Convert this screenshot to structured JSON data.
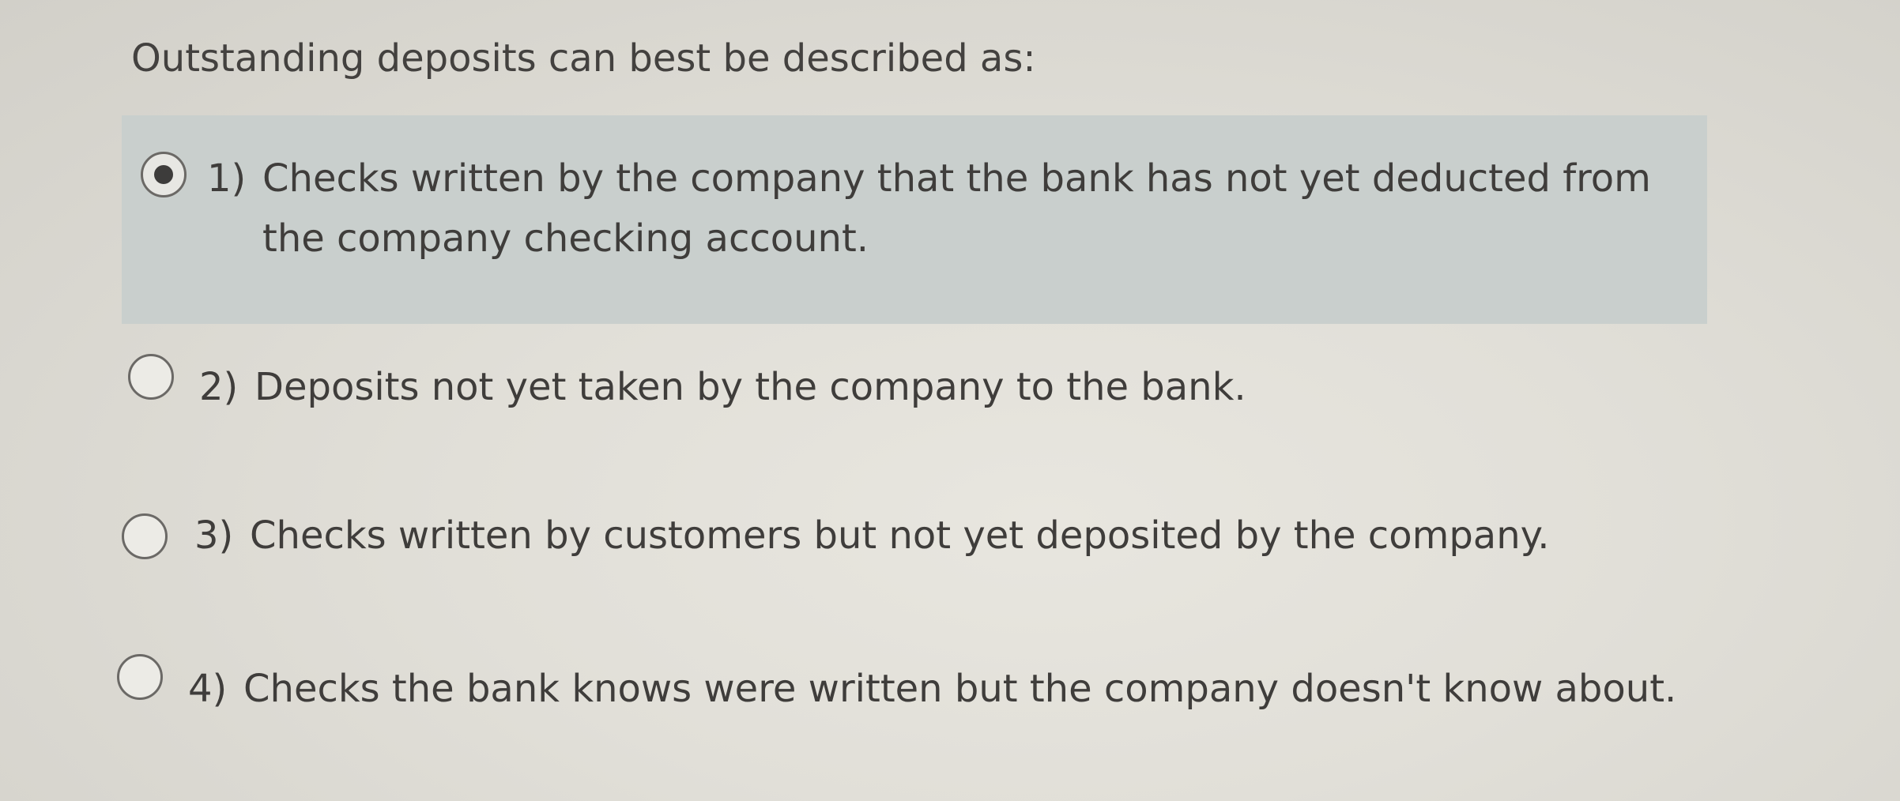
{
  "question": {
    "text": "Outstanding deposits can best be described as:"
  },
  "options": [
    {
      "number": "1)",
      "label": "Checks written by the company that the bank has not yet deducted from the company checking account.",
      "selected": true
    },
    {
      "number": "2)",
      "label": "Deposits not yet taken by the company to the bank.",
      "selected": false
    },
    {
      "number": "3)",
      "label": "Checks written by customers but not yet deposited by the company.",
      "selected": false
    },
    {
      "number": "4)",
      "label": "Checks the bank knows were written but the company doesn't know about.",
      "selected": false
    }
  ],
  "colors": {
    "selected_background": "#c9cfcd",
    "page_background": "#e1dfd8",
    "text": "#3f3d3b"
  }
}
